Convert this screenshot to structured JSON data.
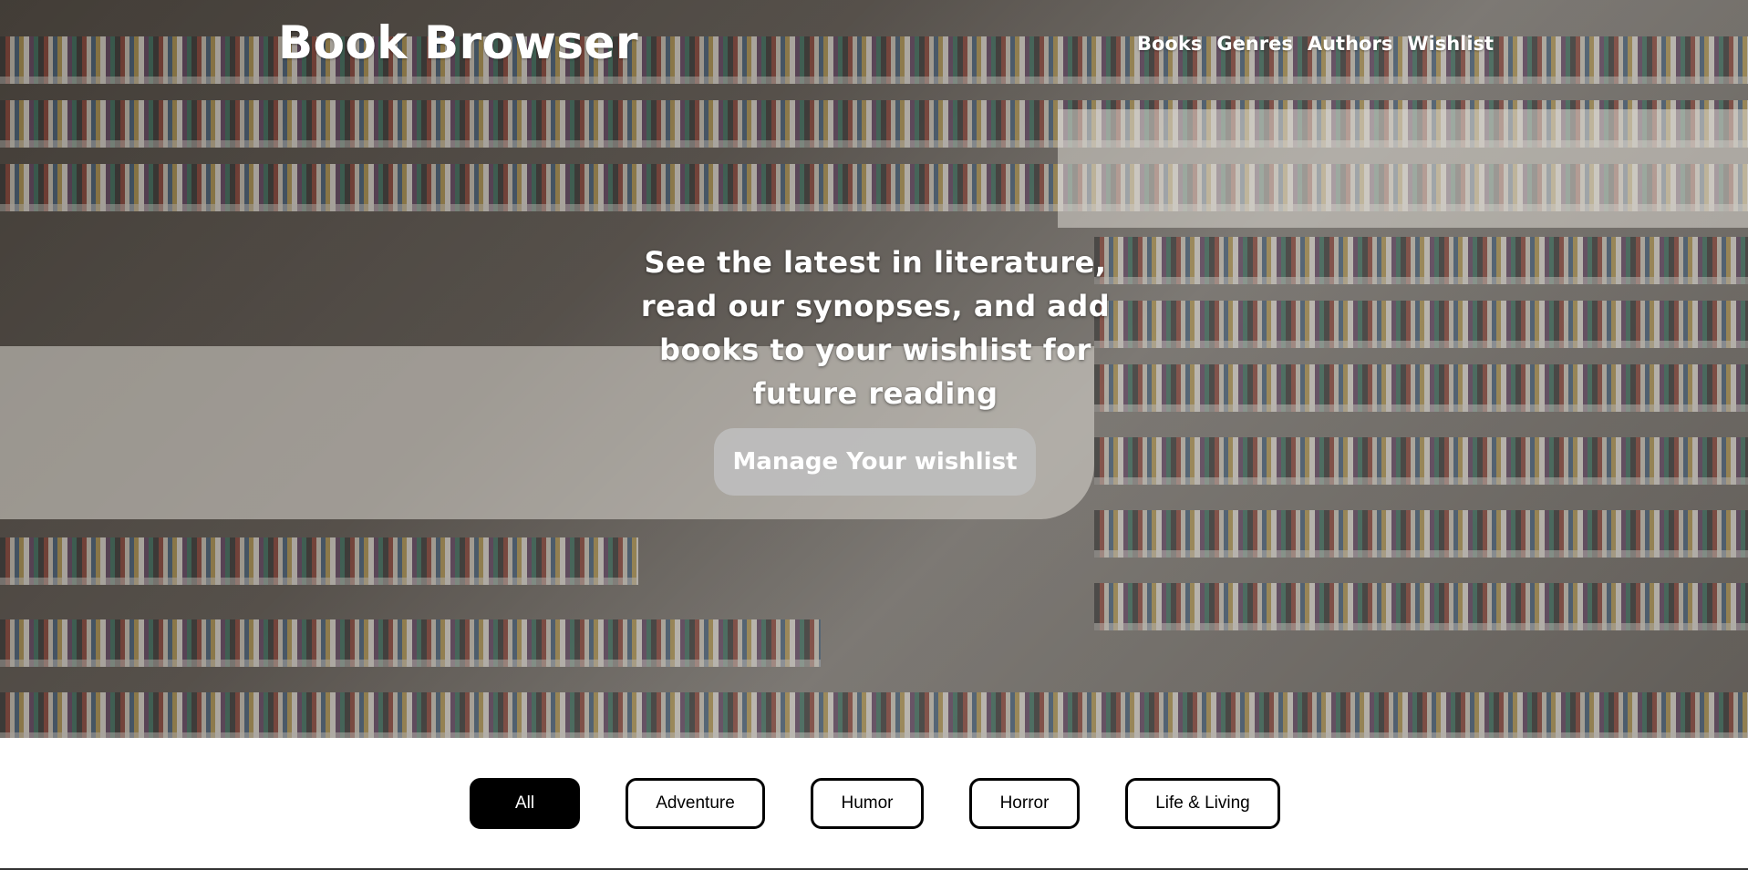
{
  "header": {
    "logo": "Book Browser",
    "nav": [
      "Books",
      "Genres",
      "Authors",
      "Wishlist"
    ]
  },
  "hero": {
    "tagline": "See the latest in literature, read our synopses, and add books to your wishlist for future reading",
    "cta_label": "Manage Your wishlist"
  },
  "filters": {
    "items": [
      "All",
      "Adventure",
      "Humor",
      "Horror",
      "Life & Living"
    ],
    "active": "All"
  },
  "colors": {
    "chip_active_bg": "#000000",
    "chip_border": "#000000",
    "cta_bg": "#bebebe",
    "text_on_hero": "#ffffff"
  }
}
